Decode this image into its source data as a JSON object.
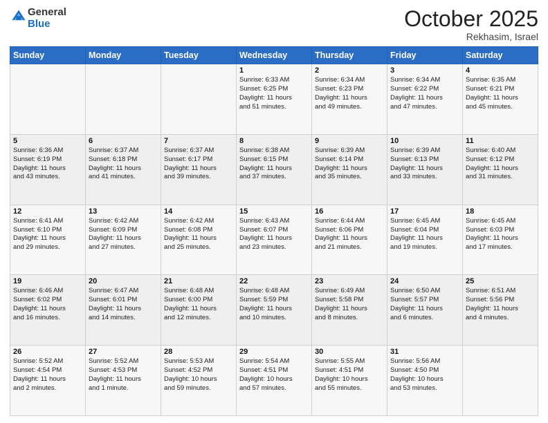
{
  "header": {
    "logo_general": "General",
    "logo_blue": "Blue",
    "month_title": "October 2025",
    "location": "Rekhasim, Israel"
  },
  "days_of_week": [
    "Sunday",
    "Monday",
    "Tuesday",
    "Wednesday",
    "Thursday",
    "Friday",
    "Saturday"
  ],
  "weeks": [
    [
      {
        "day": "",
        "info": ""
      },
      {
        "day": "",
        "info": ""
      },
      {
        "day": "",
        "info": ""
      },
      {
        "day": "1",
        "info": "Sunrise: 6:33 AM\nSunset: 6:25 PM\nDaylight: 11 hours\nand 51 minutes."
      },
      {
        "day": "2",
        "info": "Sunrise: 6:34 AM\nSunset: 6:23 PM\nDaylight: 11 hours\nand 49 minutes."
      },
      {
        "day": "3",
        "info": "Sunrise: 6:34 AM\nSunset: 6:22 PM\nDaylight: 11 hours\nand 47 minutes."
      },
      {
        "day": "4",
        "info": "Sunrise: 6:35 AM\nSunset: 6:21 PM\nDaylight: 11 hours\nand 45 minutes."
      }
    ],
    [
      {
        "day": "5",
        "info": "Sunrise: 6:36 AM\nSunset: 6:19 PM\nDaylight: 11 hours\nand 43 minutes."
      },
      {
        "day": "6",
        "info": "Sunrise: 6:37 AM\nSunset: 6:18 PM\nDaylight: 11 hours\nand 41 minutes."
      },
      {
        "day": "7",
        "info": "Sunrise: 6:37 AM\nSunset: 6:17 PM\nDaylight: 11 hours\nand 39 minutes."
      },
      {
        "day": "8",
        "info": "Sunrise: 6:38 AM\nSunset: 6:15 PM\nDaylight: 11 hours\nand 37 minutes."
      },
      {
        "day": "9",
        "info": "Sunrise: 6:39 AM\nSunset: 6:14 PM\nDaylight: 11 hours\nand 35 minutes."
      },
      {
        "day": "10",
        "info": "Sunrise: 6:39 AM\nSunset: 6:13 PM\nDaylight: 11 hours\nand 33 minutes."
      },
      {
        "day": "11",
        "info": "Sunrise: 6:40 AM\nSunset: 6:12 PM\nDaylight: 11 hours\nand 31 minutes."
      }
    ],
    [
      {
        "day": "12",
        "info": "Sunrise: 6:41 AM\nSunset: 6:10 PM\nDaylight: 11 hours\nand 29 minutes."
      },
      {
        "day": "13",
        "info": "Sunrise: 6:42 AM\nSunset: 6:09 PM\nDaylight: 11 hours\nand 27 minutes."
      },
      {
        "day": "14",
        "info": "Sunrise: 6:42 AM\nSunset: 6:08 PM\nDaylight: 11 hours\nand 25 minutes."
      },
      {
        "day": "15",
        "info": "Sunrise: 6:43 AM\nSunset: 6:07 PM\nDaylight: 11 hours\nand 23 minutes."
      },
      {
        "day": "16",
        "info": "Sunrise: 6:44 AM\nSunset: 6:06 PM\nDaylight: 11 hours\nand 21 minutes."
      },
      {
        "day": "17",
        "info": "Sunrise: 6:45 AM\nSunset: 6:04 PM\nDaylight: 11 hours\nand 19 minutes."
      },
      {
        "day": "18",
        "info": "Sunrise: 6:45 AM\nSunset: 6:03 PM\nDaylight: 11 hours\nand 17 minutes."
      }
    ],
    [
      {
        "day": "19",
        "info": "Sunrise: 6:46 AM\nSunset: 6:02 PM\nDaylight: 11 hours\nand 16 minutes."
      },
      {
        "day": "20",
        "info": "Sunrise: 6:47 AM\nSunset: 6:01 PM\nDaylight: 11 hours\nand 14 minutes."
      },
      {
        "day": "21",
        "info": "Sunrise: 6:48 AM\nSunset: 6:00 PM\nDaylight: 11 hours\nand 12 minutes."
      },
      {
        "day": "22",
        "info": "Sunrise: 6:48 AM\nSunset: 5:59 PM\nDaylight: 11 hours\nand 10 minutes."
      },
      {
        "day": "23",
        "info": "Sunrise: 6:49 AM\nSunset: 5:58 PM\nDaylight: 11 hours\nand 8 minutes."
      },
      {
        "day": "24",
        "info": "Sunrise: 6:50 AM\nSunset: 5:57 PM\nDaylight: 11 hours\nand 6 minutes."
      },
      {
        "day": "25",
        "info": "Sunrise: 6:51 AM\nSunset: 5:56 PM\nDaylight: 11 hours\nand 4 minutes."
      }
    ],
    [
      {
        "day": "26",
        "info": "Sunrise: 5:52 AM\nSunset: 4:54 PM\nDaylight: 11 hours\nand 2 minutes."
      },
      {
        "day": "27",
        "info": "Sunrise: 5:52 AM\nSunset: 4:53 PM\nDaylight: 11 hours\nand 1 minute."
      },
      {
        "day": "28",
        "info": "Sunrise: 5:53 AM\nSunset: 4:52 PM\nDaylight: 10 hours\nand 59 minutes."
      },
      {
        "day": "29",
        "info": "Sunrise: 5:54 AM\nSunset: 4:51 PM\nDaylight: 10 hours\nand 57 minutes."
      },
      {
        "day": "30",
        "info": "Sunrise: 5:55 AM\nSunset: 4:51 PM\nDaylight: 10 hours\nand 55 minutes."
      },
      {
        "day": "31",
        "info": "Sunrise: 5:56 AM\nSunset: 4:50 PM\nDaylight: 10 hours\nand 53 minutes."
      },
      {
        "day": "",
        "info": ""
      }
    ]
  ]
}
